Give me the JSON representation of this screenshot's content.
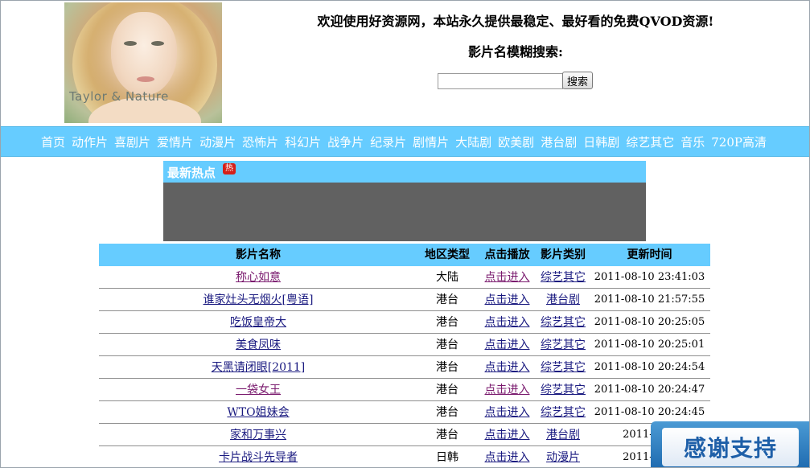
{
  "header": {
    "banner_text": "Taylor & Nature",
    "welcome": "欢迎使用好资源网，本站永久提供最稳定、最好看的免费QVOD资源!",
    "search_title": "影片名模糊搜索:",
    "search_value": "",
    "search_button": "搜索"
  },
  "nav": {
    "items": [
      "首页",
      "动作片",
      "喜剧片",
      "爱情片",
      "动漫片",
      "恐怖片",
      "科幻片",
      "战争片",
      "纪录片",
      "剧情片",
      "大陆剧",
      "欧美剧",
      "港台剧",
      "日韩剧",
      "综艺其它",
      "音乐",
      "720P高清"
    ]
  },
  "hot": {
    "title": "最新热点",
    "badge": "热"
  },
  "table": {
    "headers": [
      "影片名称",
      "地区类型",
      "点击播放",
      "影片类别",
      "更新时间"
    ],
    "rows": [
      {
        "name": "称心如意",
        "region": "大陆",
        "play": "点击进入",
        "category": "综艺其它",
        "time": "2011-08-10 23:41:03"
      },
      {
        "name": "谁家灶头无烟火[粤语]",
        "region": "港台",
        "play": "点击进入",
        "category": "港台剧",
        "time": "2011-08-10 21:57:55"
      },
      {
        "name": "吃饭皇帝大",
        "region": "港台",
        "play": "点击进入",
        "category": "综艺其它",
        "time": "2011-08-10 20:25:05"
      },
      {
        "name": "美食凤味",
        "region": "港台",
        "play": "点击进入",
        "category": "综艺其它",
        "time": "2011-08-10 20:25:01"
      },
      {
        "name": "天黑请闭眼[2011]",
        "region": "港台",
        "play": "点击进入",
        "category": "综艺其它",
        "time": "2011-08-10 20:24:54"
      },
      {
        "name": "一袋女王",
        "region": "港台",
        "play": "点击进入",
        "category": "综艺其它",
        "time": "2011-08-10 20:24:47"
      },
      {
        "name": "WTO姐妹会",
        "region": "港台",
        "play": "点击进入",
        "category": "综艺其它",
        "time": "2011-08-10 20:24:45"
      },
      {
        "name": "家和万事兴",
        "region": "港台",
        "play": "点击进入",
        "category": "港台剧",
        "time": "2011-08-1"
      },
      {
        "name": "卡片战斗先导者",
        "region": "日韩",
        "play": "点击进入",
        "category": "动漫片",
        "time": "2011-08-1"
      }
    ]
  },
  "thanks": {
    "text": "感谢支持"
  }
}
